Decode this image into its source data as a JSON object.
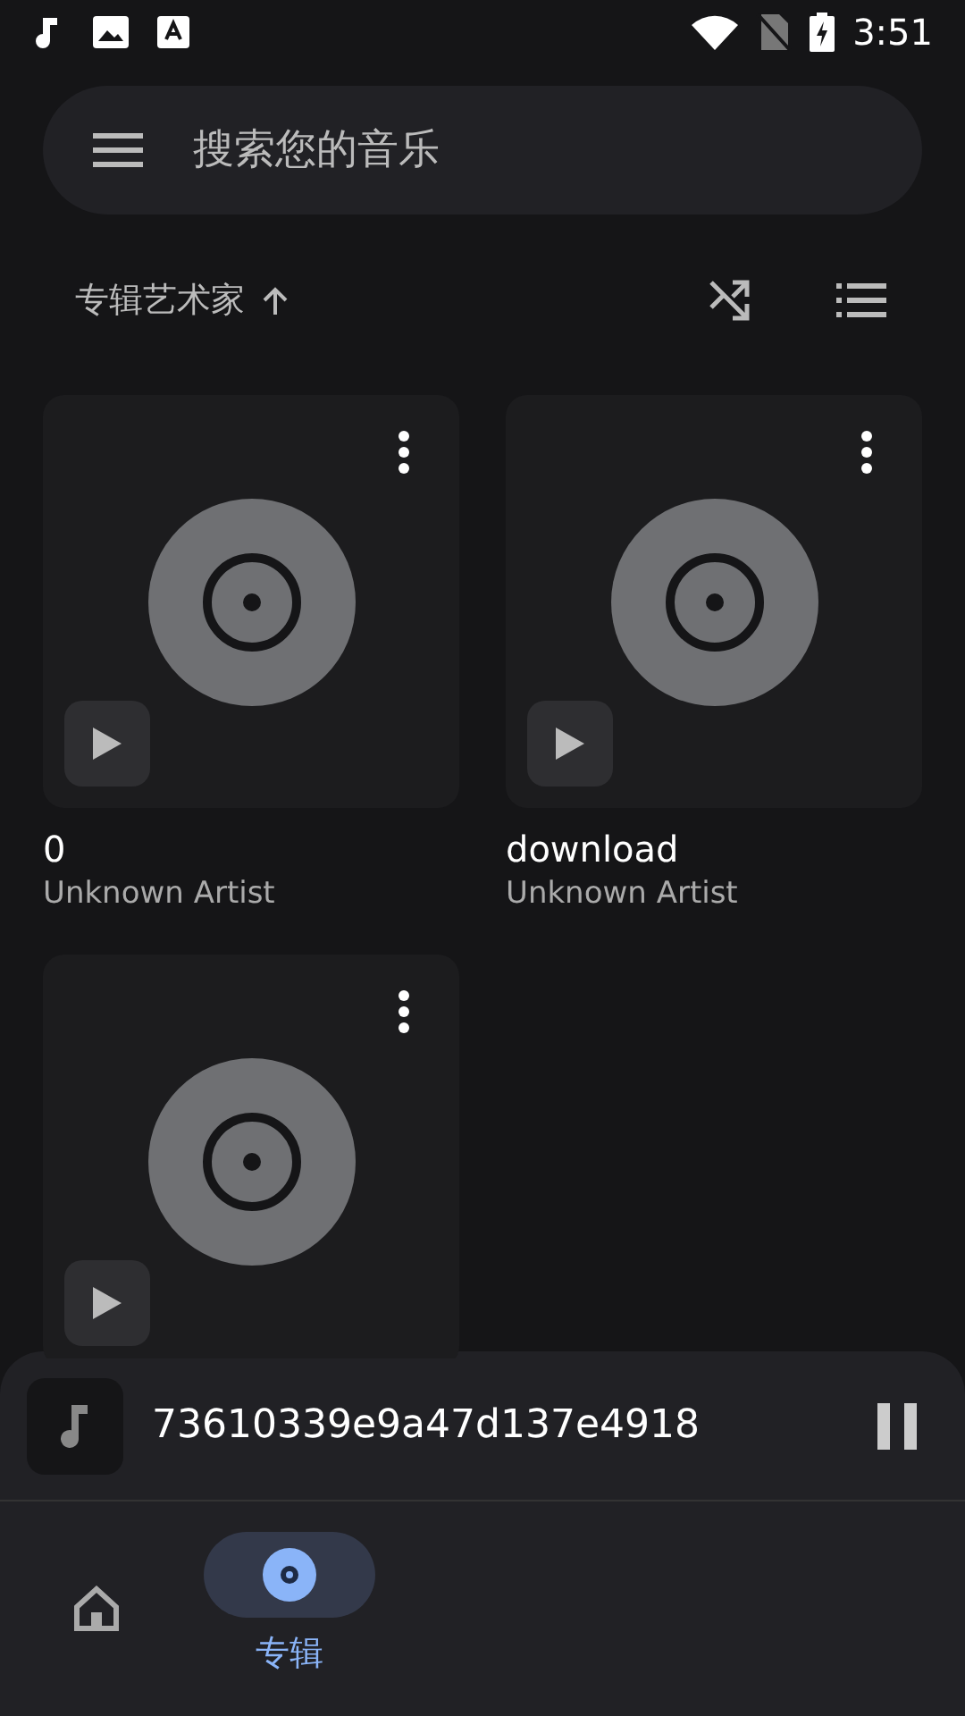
{
  "status_bar": {
    "time": "3:51"
  },
  "search": {
    "placeholder": "搜索您的音乐"
  },
  "sort": {
    "label": "专辑艺术家",
    "ascending": true
  },
  "albums": [
    {
      "kind": "album",
      "title": "0",
      "artist": "Unknown Artist"
    },
    {
      "kind": "album",
      "title": "download",
      "artist": "Unknown Artist"
    },
    {
      "kind": "album"
    }
  ],
  "now_playing": {
    "title": "73610339e9a47d137e4918",
    "playing": true
  },
  "nav": [
    {
      "kind": "home",
      "selected": false
    },
    {
      "kind": "album",
      "label": "专辑",
      "selected": true
    }
  ]
}
